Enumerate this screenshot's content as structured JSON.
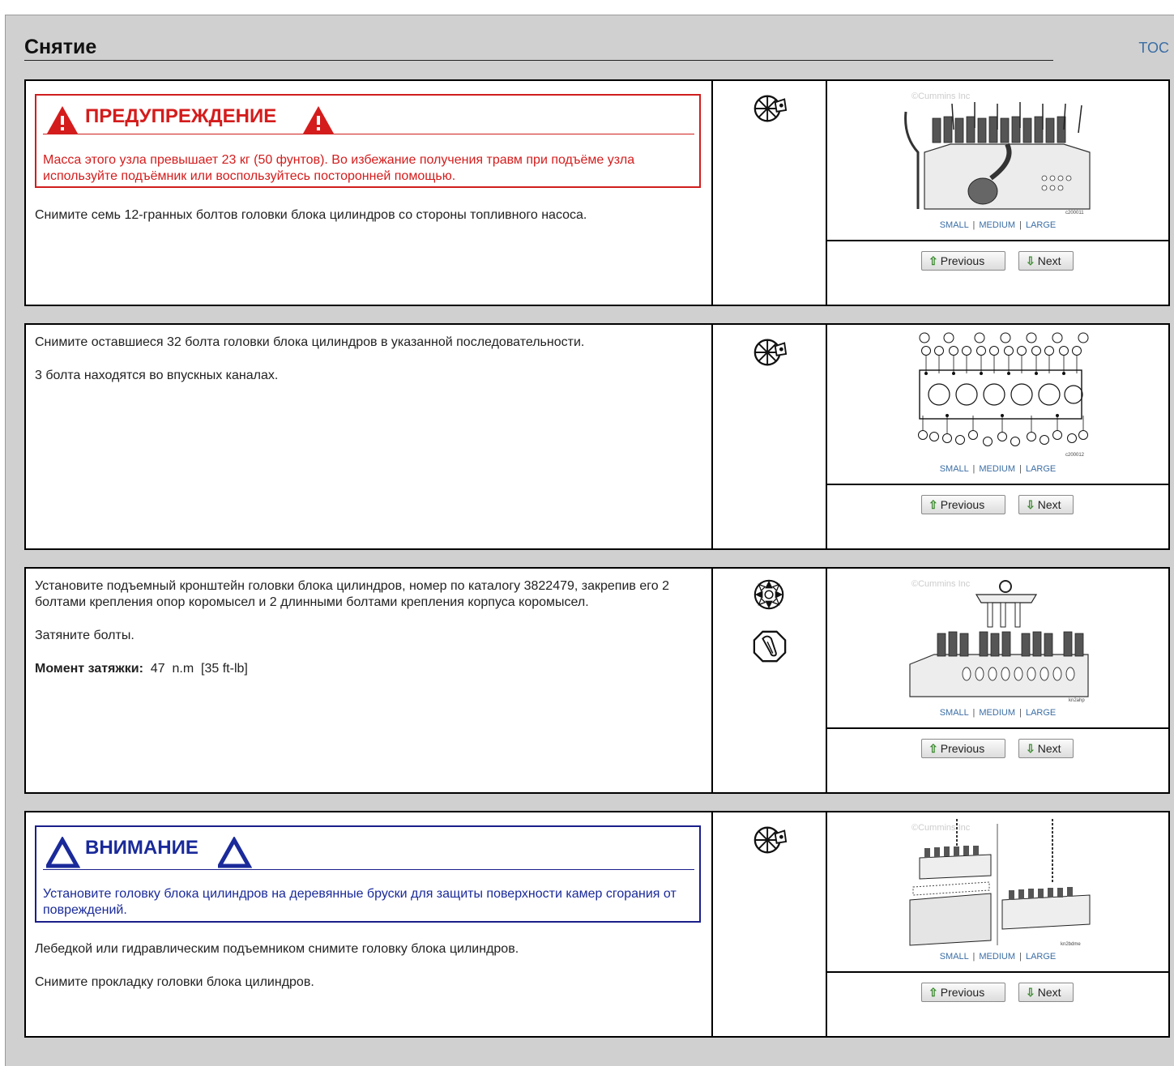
{
  "header": {
    "title": "Снятие",
    "toc_label": "TOC"
  },
  "figure": {
    "size_links": [
      "SMALL",
      "MEDIUM",
      "LARGE"
    ],
    "separator": "|",
    "prev_label": "Previous",
    "next_label": "Next",
    "watermark": "©Cummins Inc"
  },
  "steps": [
    {
      "warning": {
        "title": "ПРЕДУПРЕЖДЕНИЕ",
        "text": "Масса этого узла превышает 23 кг (50 фунтов). Во избежание получения травм при подъёме узла используйте подъёмник или воспользуйтесь посторонней помощью."
      },
      "paragraphs": [
        "Снимите семь 12-гранных болтов головки блока цилиндров со стороны топливного насоса."
      ],
      "icons": [
        "wrench-wheel-icon"
      ],
      "image_code": "c200011"
    },
    {
      "paragraphs": [
        "Снимите оставшиеся 32 болта головки блока цилиндров в указанной последовательности.",
        "3 болта находятся во впускных каналах."
      ],
      "icons": [
        "wrench-wheel-icon"
      ],
      "image_code": "c200012"
    },
    {
      "paragraphs": [
        "Установите подъемный кронштейн головки блока цилиндров, номер по каталогу 3822479, закрепив его 2 болтами крепления опор коромысел и 2 длинными болтами крепления корпуса коромысел.",
        "Затяните болты."
      ],
      "torque": {
        "label": "Момент затяжки:",
        "value": "47",
        "unit": "n.m",
        "imperial": "[35 ft-lb]"
      },
      "icons": [
        "special-tool-icon",
        "torque-wrench-icon"
      ],
      "image_code": "kn2ahp"
    },
    {
      "caution": {
        "title": "ВНИМАНИЕ",
        "text": "Установите головку блока цилиндров на деревянные бруски для защиты поверхности камер сгорания от повреждений."
      },
      "paragraphs": [
        "Лебедкой или гидравлическим подъемником снимите головку блока цилиндров.",
        "Снимите прокладку головки блока цилиндров."
      ],
      "icons": [
        "wrench-wheel-icon"
      ],
      "image_code": "kn2bdme"
    }
  ]
}
